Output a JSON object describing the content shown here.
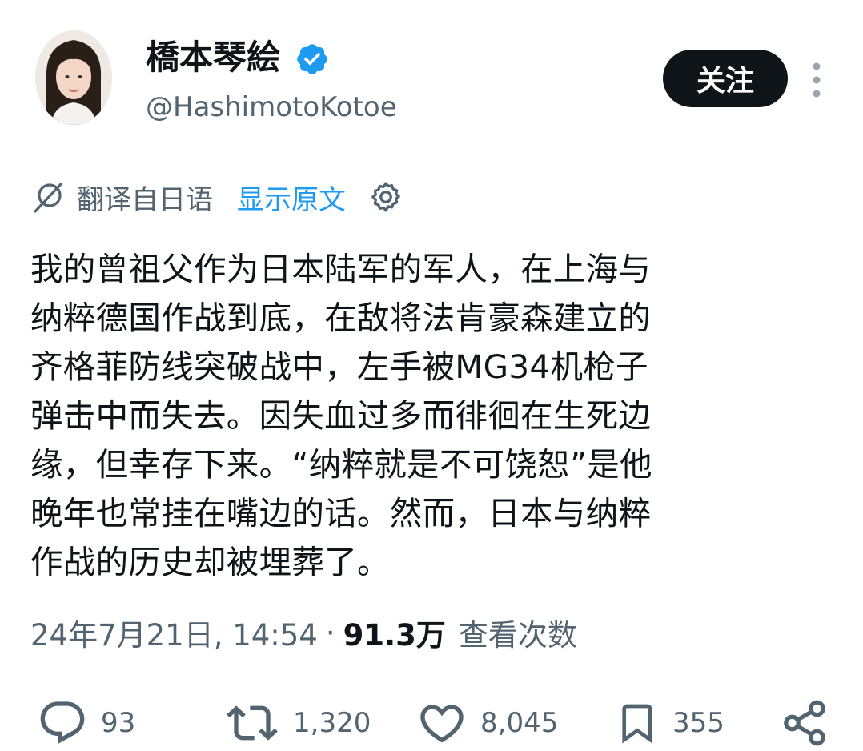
{
  "profile": {
    "display_name": "橋本琴絵",
    "handle": "@HashimotoKotoe",
    "verified": true,
    "follow_label": "关注"
  },
  "translation": {
    "from_label": "翻译自日语",
    "show_original_label": "显示原文"
  },
  "tweet": {
    "lines": [
      "我的曾祖父作为日本陆军的军人，在上海与",
      "纳粹德国作战到底，在敌将法肯豪森建立的",
      "齐格菲防线突破战中，左手被MG34机枪子",
      "弹击中而失去。因失血过多而徘徊在生死边",
      "缘，但幸存下来。“纳粹就是不可饶恕”是他",
      "晚年也常挂在嘴边的话。然而，日本与纳粹",
      "作战的历史却被埋葬了。"
    ]
  },
  "meta": {
    "timestamp": "24年7月21日, 14:54",
    "separator": "·",
    "views_count": "91.3万",
    "views_label": "查看次数"
  },
  "actions": {
    "replies": "93",
    "retweets": "1,320",
    "likes": "8,045",
    "bookmarks": "355"
  },
  "colors": {
    "text": "#0f1419",
    "secondary": "#536471",
    "link": "#1d9bf0",
    "badge": "#1d9bf0",
    "follow_bg": "#0f1419"
  },
  "icons": {
    "verified": "verified-badge-icon",
    "translate": "translate-icon",
    "settings": "gear-icon",
    "more": "more-vertical-icon",
    "reply": "reply-icon",
    "retweet": "retweet-icon",
    "like": "heart-icon",
    "bookmark": "bookmark-icon",
    "share": "share-icon"
  }
}
